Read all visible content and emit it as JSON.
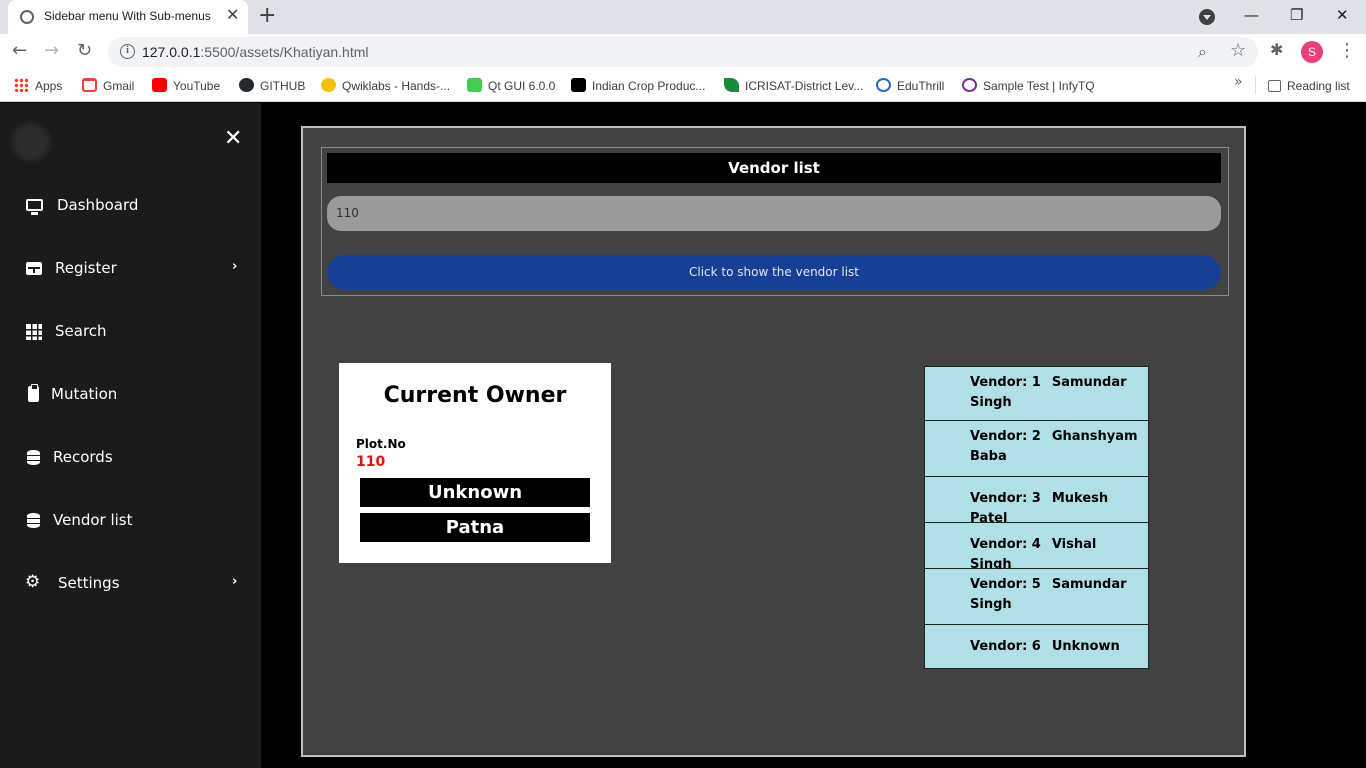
{
  "browser": {
    "tab_title": "Sidebar menu With Sub-menus |",
    "url_host": "127.0.0.1",
    "url_rest": ":5500/assets/Khatiyan.html",
    "profile_initial": "S",
    "reading_list": "Reading list",
    "bookmarks": [
      {
        "label": "Apps",
        "icon": "apps-grid-icon",
        "color": "#ea4335"
      },
      {
        "label": "Gmail",
        "icon": "gmail-icon",
        "color": "#ea4335"
      },
      {
        "label": "YouTube",
        "icon": "youtube-icon",
        "color": "#ff0000"
      },
      {
        "label": "GITHUB",
        "icon": "github-icon",
        "color": "#24292e"
      },
      {
        "label": "Qwiklabs - Hands-...",
        "icon": "qwiklabs-icon",
        "color": "#f4c20d"
      },
      {
        "label": "Qt GUI 6.0.0",
        "icon": "qt-icon",
        "color": "#41cd52"
      },
      {
        "label": "Indian Crop Produc...",
        "icon": "medium-icon",
        "color": "#000000"
      },
      {
        "label": "ICRISAT-District Lev...",
        "icon": "icrisat-icon",
        "color": "#1a8a3a"
      },
      {
        "label": "EduThrill",
        "icon": "eduthrill-icon",
        "color": "#2a6bb3"
      },
      {
        "label": "Sample Test | InfyTQ",
        "icon": "infytq-icon",
        "color": "#7b2d8e"
      }
    ]
  },
  "sidebar": {
    "items": [
      {
        "label": "Dashboard",
        "icon": "monitor-icon"
      },
      {
        "label": "Register",
        "icon": "table-icon",
        "has_submenu": true
      },
      {
        "label": "Search",
        "icon": "grid-icon"
      },
      {
        "label": "Mutation",
        "icon": "clipboard-icon"
      },
      {
        "label": "Records",
        "icon": "database-icon"
      },
      {
        "label": "Vendor list",
        "icon": "database-icon"
      },
      {
        "label": "Settings",
        "icon": "cogs-icon",
        "has_submenu": true
      }
    ]
  },
  "vendor_search": {
    "header": "Vendor list",
    "input_value": "110",
    "button_label": "Click to show the vendor list"
  },
  "owner_card": {
    "title": "Current Owner",
    "plot_label": "Plot.No",
    "plot_value": "110",
    "owner_name": "Unknown",
    "location": "Patna"
  },
  "vendors": [
    {
      "num": "Vendor: 1",
      "name": "Samundar Singh"
    },
    {
      "num": "Vendor: 2",
      "name": "Ghanshyam Baba"
    },
    {
      "num": "Vendor: 3",
      "name": "Mukesh Patel"
    },
    {
      "num": "Vendor: 4",
      "name": "Vishal Singh"
    },
    {
      "num": "Vendor: 5",
      "name": "Samundar Singh"
    },
    {
      "num": "Vendor: 6",
      "name": "Unknown"
    }
  ],
  "colors": {
    "sidebar_bg": "#1b1b1b",
    "panel_bg": "#424242",
    "button_blue": "#173f96",
    "vendor_row_bg": "#b0e0e6",
    "plot_value_red": "#e01010"
  }
}
